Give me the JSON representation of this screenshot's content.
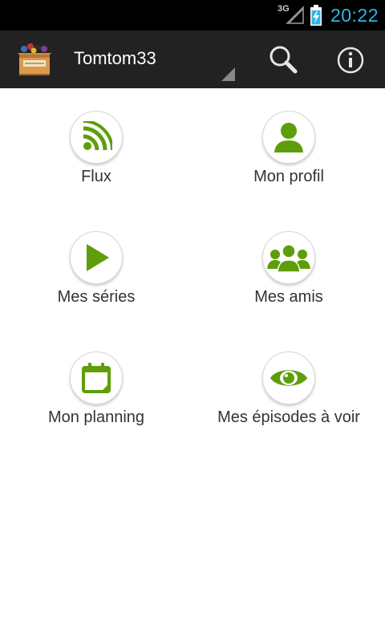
{
  "status_bar": {
    "network": "3G",
    "time": "20:22"
  },
  "action_bar": {
    "title": "Tomtom33",
    "app_icon": "box-icon",
    "search_icon": "search-icon",
    "info_icon": "info-icon"
  },
  "menu": {
    "items": [
      {
        "label": "Flux",
        "icon": "rss-icon"
      },
      {
        "label": "Mon profil",
        "icon": "user-icon"
      },
      {
        "label": "Mes séries",
        "icon": "play-icon"
      },
      {
        "label": "Mes amis",
        "icon": "group-icon"
      },
      {
        "label": "Mon planning",
        "icon": "calendar-icon"
      },
      {
        "label": "Mes épisodes à voir",
        "icon": "eye-icon"
      }
    ]
  },
  "colors": {
    "accent_green": "#5e9e0a",
    "clock_blue": "#33b5e5",
    "action_bar": "#222222"
  }
}
